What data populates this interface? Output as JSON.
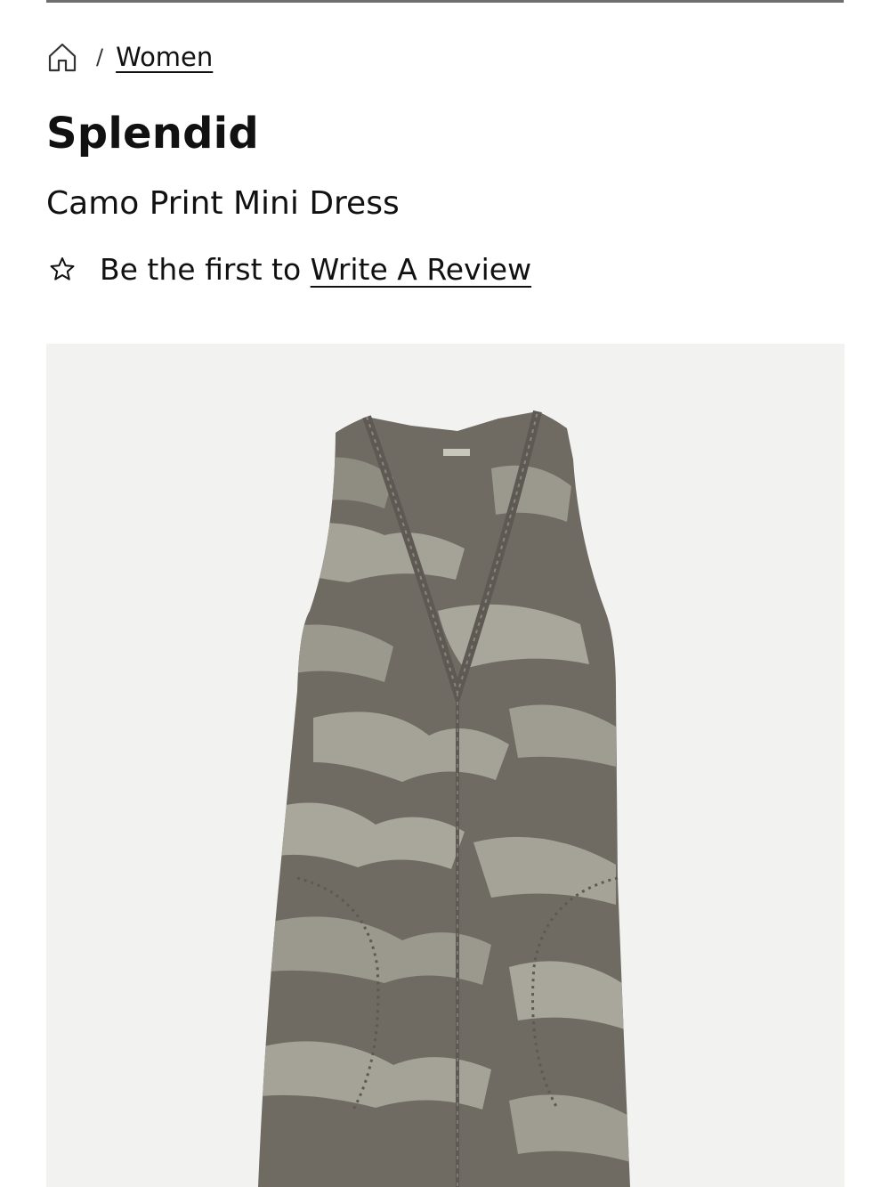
{
  "breadcrumb": {
    "home_icon": "home-icon",
    "separator": "/",
    "current": "Women"
  },
  "product": {
    "brand": "Splendid",
    "name": "Camo Print Mini Dress"
  },
  "reviews": {
    "star_icon": "star-outline-icon",
    "prefix": "Be the first to ",
    "link_label": "Write A Review"
  },
  "colors": {
    "text": "#111111",
    "divider": "#6e6e6e",
    "image_bg": "#f2f2f1",
    "camo_dark": "#6f6b63",
    "camo_light": "#a5a398"
  }
}
